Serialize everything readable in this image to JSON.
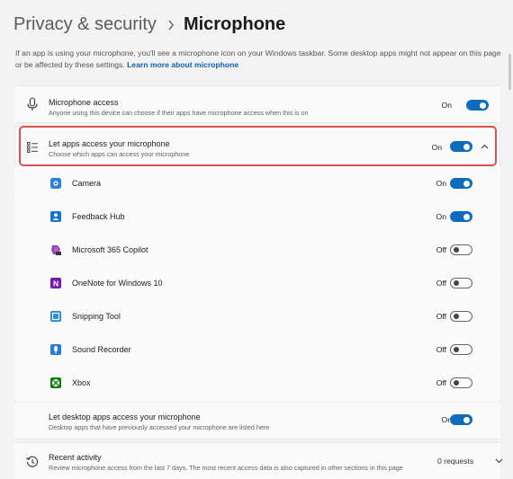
{
  "breadcrumb": {
    "parent": "Privacy & security",
    "separator_icon": "chevron-right-icon",
    "current": "Microphone"
  },
  "description": {
    "text": "If an app is using your microphone, you'll see a microphone icon on your Windows taskbar. Some desktop apps might not appear on this page or be affected by these settings.",
    "link": "Learn more about microphone"
  },
  "microphone_access": {
    "title": "Microphone access",
    "subtitle": "Anyone using this device can choose if their apps have microphone access when this is on",
    "state": "On",
    "icon": "microphone-icon",
    "enabled": true
  },
  "apps_access": {
    "title": "Let apps access your microphone",
    "subtitle": "Choose which apps can access your microphone",
    "state": "On",
    "icon": "list-icon",
    "enabled": true,
    "expanded": true
  },
  "apps": [
    {
      "name": "Camera",
      "state": "On",
      "enabled": true,
      "icon": "camera-app-icon",
      "color": "#2f7fd6"
    },
    {
      "name": "Feedback Hub",
      "state": "On",
      "enabled": true,
      "icon": "feedback-hub-icon",
      "color": "#1a73c8"
    },
    {
      "name": "Microsoft 365 Copilot",
      "state": "Off",
      "enabled": false,
      "icon": "copilot-icon",
      "color": "#7b4bd8"
    },
    {
      "name": "OneNote for Windows 10",
      "state": "Off",
      "enabled": false,
      "icon": "onenote-icon",
      "color": "#7719aa"
    },
    {
      "name": "Snipping Tool",
      "state": "Off",
      "enabled": false,
      "icon": "snipping-tool-icon",
      "color": "#2a8ad8"
    },
    {
      "name": "Sound Recorder",
      "state": "Off",
      "enabled": false,
      "icon": "sound-recorder-icon",
      "color": "#2a7bd0"
    },
    {
      "name": "Xbox",
      "state": "Off",
      "enabled": false,
      "icon": "xbox-icon",
      "color": "#107c10"
    }
  ],
  "desktop_apps": {
    "title": "Let desktop apps access your microphone",
    "subtitle": "Desktop apps that have previously accessed your microphone are listed here",
    "state": "On",
    "enabled": true
  },
  "recent_activity": {
    "title": "Recent activity",
    "subtitle": "Review microphone access from the last 7 days. The most recent access data is also captured in other sections in this page",
    "requests": "0 requests",
    "icon": "history-icon"
  },
  "colors": {
    "accent": "#0f6cbd",
    "highlight": "#d9534f"
  }
}
